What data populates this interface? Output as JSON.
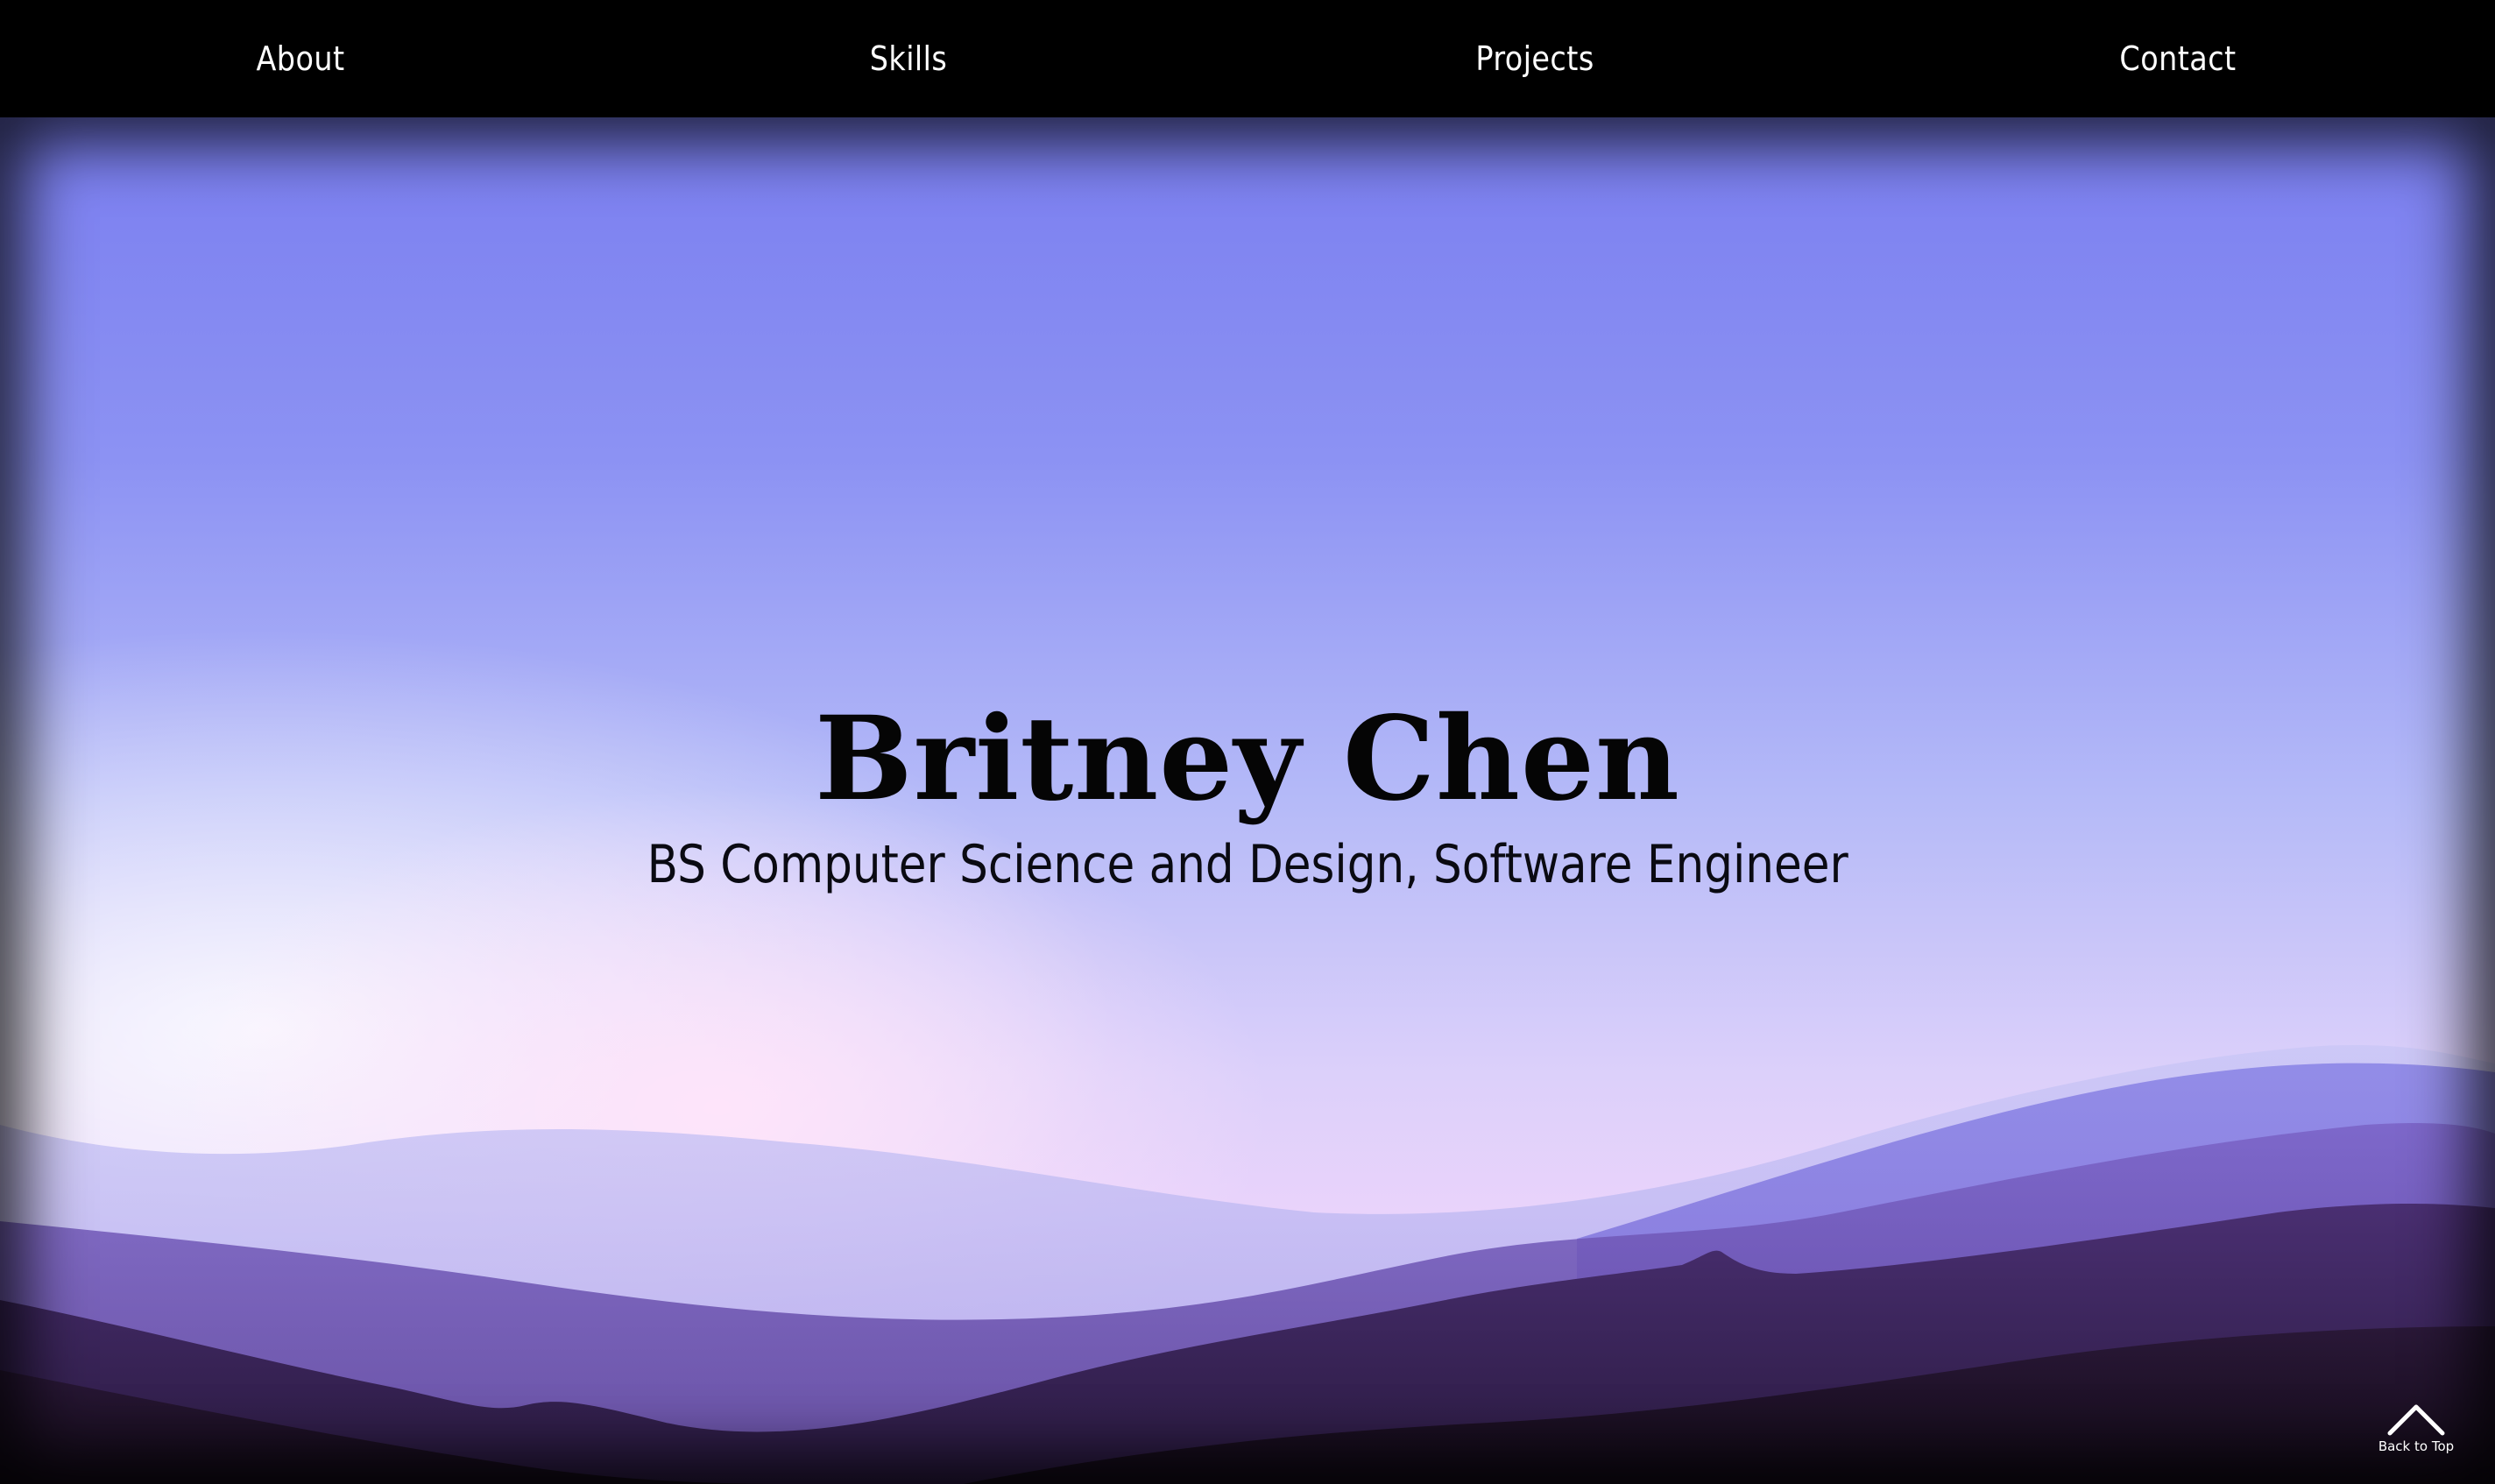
{
  "nav": {
    "items": [
      {
        "label": "About"
      },
      {
        "label": "Skills"
      },
      {
        "label": "Projects"
      },
      {
        "label": "Contact"
      }
    ]
  },
  "hero": {
    "title": "Britney Chen",
    "subtitle": "BS Computer Science and Design, Software Engineer",
    "background": "purple-mountain-sunrise",
    "colors": {
      "sky_top": "#7a7ef0",
      "glow": "#ffe4fa",
      "mountain_dark": "#1a0f24"
    }
  },
  "back_to_top": {
    "label": "Back to Top",
    "icon": "chevron-up-icon"
  }
}
